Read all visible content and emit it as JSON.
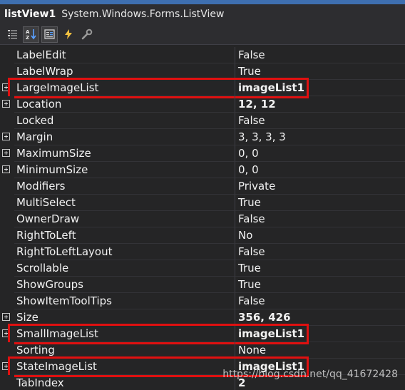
{
  "title": {
    "object_name": "listView1",
    "object_type": "System.Windows.Forms.ListView"
  },
  "toolbar": {
    "buttons": [
      {
        "icon": "categorized-icon",
        "active": false
      },
      {
        "icon": "alphabetical-icon",
        "active": true
      },
      {
        "icon": "properties-icon",
        "active": true
      },
      {
        "icon": "events-icon",
        "active": false
      },
      {
        "icon": "property-pages-icon",
        "active": false
      }
    ]
  },
  "properties": [
    {
      "name": "LabelEdit",
      "value": "False",
      "expandable": false,
      "bold": false,
      "highlight": false
    },
    {
      "name": "LabelWrap",
      "value": "True",
      "expandable": false,
      "bold": false,
      "highlight": false
    },
    {
      "name": "LargeImageList",
      "value": "imageList1",
      "expandable": true,
      "bold": true,
      "highlight": true
    },
    {
      "name": "Location",
      "value": "12, 12",
      "expandable": true,
      "bold": true,
      "highlight": false
    },
    {
      "name": "Locked",
      "value": "False",
      "expandable": false,
      "bold": false,
      "highlight": false
    },
    {
      "name": "Margin",
      "value": "3, 3, 3, 3",
      "expandable": true,
      "bold": false,
      "highlight": false
    },
    {
      "name": "MaximumSize",
      "value": "0, 0",
      "expandable": true,
      "bold": false,
      "highlight": false
    },
    {
      "name": "MinimumSize",
      "value": "0, 0",
      "expandable": true,
      "bold": false,
      "highlight": false
    },
    {
      "name": "Modifiers",
      "value": "Private",
      "expandable": false,
      "bold": false,
      "highlight": false
    },
    {
      "name": "MultiSelect",
      "value": "True",
      "expandable": false,
      "bold": false,
      "highlight": false
    },
    {
      "name": "OwnerDraw",
      "value": "False",
      "expandable": false,
      "bold": false,
      "highlight": false
    },
    {
      "name": "RightToLeft",
      "value": "No",
      "expandable": false,
      "bold": false,
      "highlight": false
    },
    {
      "name": "RightToLeftLayout",
      "value": "False",
      "expandable": false,
      "bold": false,
      "highlight": false
    },
    {
      "name": "Scrollable",
      "value": "True",
      "expandable": false,
      "bold": false,
      "highlight": false
    },
    {
      "name": "ShowGroups",
      "value": "True",
      "expandable": false,
      "bold": false,
      "highlight": false
    },
    {
      "name": "ShowItemToolTips",
      "value": "False",
      "expandable": false,
      "bold": false,
      "highlight": false
    },
    {
      "name": "Size",
      "value": "356, 426",
      "expandable": true,
      "bold": true,
      "highlight": false
    },
    {
      "name": "SmallImageList",
      "value": "imageList1",
      "expandable": true,
      "bold": true,
      "highlight": true
    },
    {
      "name": "Sorting",
      "value": "None",
      "expandable": false,
      "bold": false,
      "highlight": false
    },
    {
      "name": "StateImageList",
      "value": "imageList1",
      "expandable": true,
      "bold": true,
      "highlight": true
    },
    {
      "name": "TabIndex",
      "value": "2",
      "expandable": false,
      "bold": true,
      "highlight": false
    }
  ],
  "colors": {
    "highlight": "#e01010",
    "background": "#252526"
  },
  "watermark": "https://blog.csdn.net/qq_41672428"
}
